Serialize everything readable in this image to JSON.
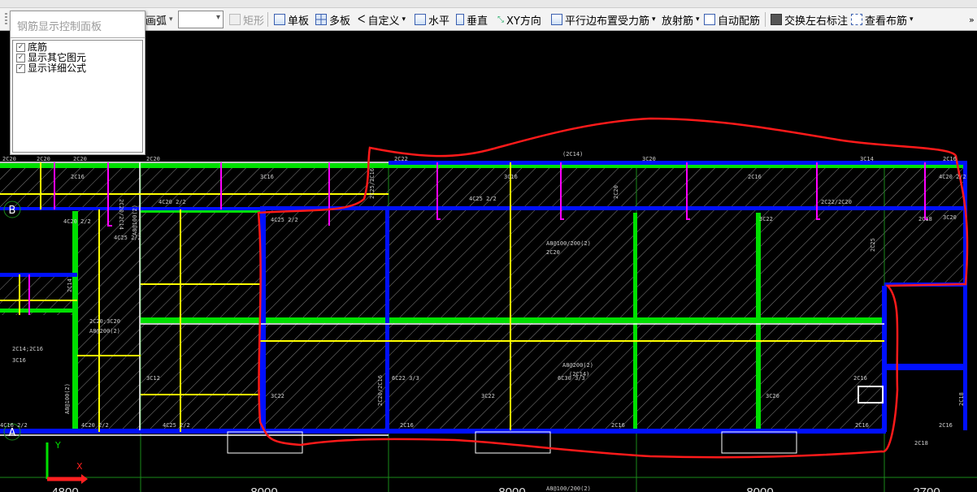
{
  "toolbar": {
    "arc": "画弧",
    "rect": "矩形",
    "single": "单板",
    "multi": "多板",
    "custom": "自定义",
    "horizontal": "水平",
    "vertical": "垂直",
    "xy": "XY方向",
    "parallel": "平行边布置受力筋",
    "radial": "放射筋",
    "auto": "自动配筋",
    "swap": "交换左右标注",
    "view": "查看布筋",
    "more": "»",
    "dropdown": "▾"
  },
  "panel": {
    "title": "钢筋显示控制面板",
    "options": [
      {
        "label": "底筋",
        "checked": true
      },
      {
        "label": "显示其它图元",
        "checked": true
      },
      {
        "label": "显示详细公式",
        "checked": true
      }
    ]
  },
  "axes": {
    "rows": [
      "B",
      "A"
    ],
    "dimensions": [
      "4800",
      "8000",
      "8000",
      "8000",
      "2700"
    ],
    "ucs_x": "X",
    "ucs_y": "Y"
  },
  "drawing": {
    "labels": [
      "2C20",
      "2C20",
      "2C20",
      "2C20",
      "2C22",
      "(2C14)",
      "3C20",
      "3C14",
      "2C16",
      "2C16",
      "3C16",
      "3C16",
      "2C16",
      "4C20 2/2",
      "4C20 2/2",
      "4C20 2/2",
      "4C25 2/2",
      "2C20/2C14",
      "2C25/2C16",
      "2C20",
      "2C22/2C20",
      "4C25 2/2",
      "3C20",
      "4C25 2/2",
      "A8@100(2)",
      "2C20;3C20",
      "A8@200(2)",
      "2C14;2C16",
      "3C16",
      "2C14",
      "3C12",
      "A8@100(2)",
      "4C20 2/2",
      "4C16 2/2",
      "4C25 2/2",
      "3C22",
      "2C20/2C16",
      "A8@100/200(2)",
      "2C20",
      "2C25",
      "3C22",
      "2C18",
      "6C22 3/3",
      "A8@200(2)",
      "(2C14)",
      "6C30 3/3",
      "3C22",
      "3C20",
      "2C16",
      "2C16",
      "2C16",
      "2C16",
      "2C16",
      "2C18",
      "2C18",
      "A8@100/200(2)"
    ]
  }
}
